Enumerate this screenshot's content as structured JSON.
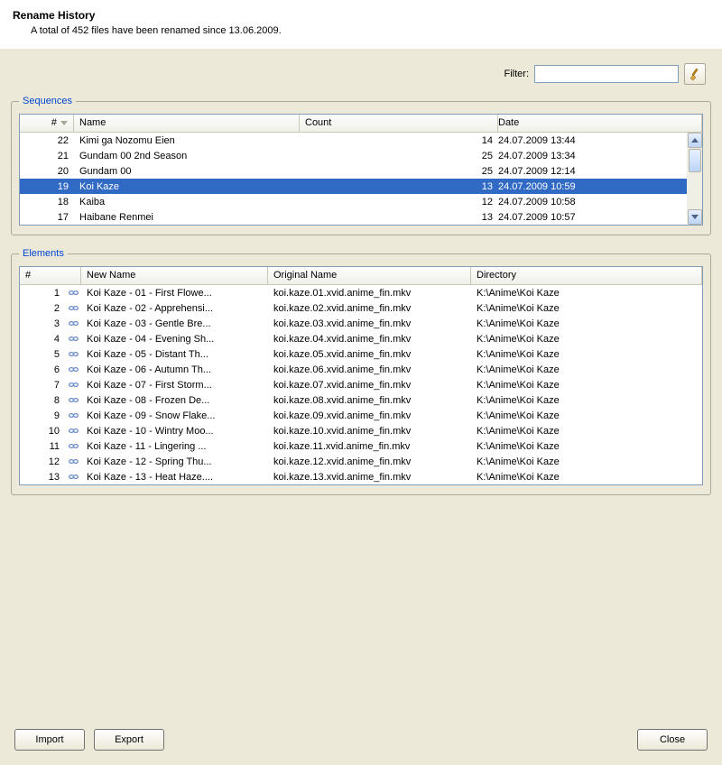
{
  "header": {
    "title": "Rename History",
    "subtitle": "A total of 452 files have been renamed since 13.06.2009."
  },
  "filter": {
    "label": "Filter:",
    "value": ""
  },
  "sequences": {
    "legend": "Sequences",
    "columns": {
      "num": "#",
      "name": "Name",
      "count": "Count",
      "date": "Date"
    },
    "rows": [
      {
        "num": "22",
        "name": "Kimi ga Nozomu Eien",
        "count": "14",
        "date": "24.07.2009 13:44",
        "selected": false
      },
      {
        "num": "21",
        "name": "Gundam 00 2nd Season",
        "count": "25",
        "date": "24.07.2009 13:34",
        "selected": false
      },
      {
        "num": "20",
        "name": "Gundam 00",
        "count": "25",
        "date": "24.07.2009 12:14",
        "selected": false
      },
      {
        "num": "19",
        "name": "Koi Kaze",
        "count": "13",
        "date": "24.07.2009 10:59",
        "selected": true
      },
      {
        "num": "18",
        "name": "Kaiba",
        "count": "12",
        "date": "24.07.2009 10:58",
        "selected": false
      },
      {
        "num": "17",
        "name": "Haibane Renmei",
        "count": "13",
        "date": "24.07.2009 10:57",
        "selected": false
      }
    ]
  },
  "elements": {
    "legend": "Elements",
    "columns": {
      "num": "#",
      "new": "New Name",
      "orig": "Original Name",
      "dir": "Directory"
    },
    "rows": [
      {
        "num": "1",
        "new": "Koi Kaze - 01 - First Flowe...",
        "orig": "koi.kaze.01.xvid.anime_fin.mkv",
        "dir": "K:\\Anime\\Koi Kaze"
      },
      {
        "num": "2",
        "new": "Koi Kaze - 02 - Apprehensi...",
        "orig": "koi.kaze.02.xvid.anime_fin.mkv",
        "dir": "K:\\Anime\\Koi Kaze"
      },
      {
        "num": "3",
        "new": "Koi Kaze - 03 - Gentle Bre...",
        "orig": "koi.kaze.03.xvid.anime_fin.mkv",
        "dir": "K:\\Anime\\Koi Kaze"
      },
      {
        "num": "4",
        "new": "Koi Kaze - 04 - Evening Sh...",
        "orig": "koi.kaze.04.xvid.anime_fin.mkv",
        "dir": "K:\\Anime\\Koi Kaze"
      },
      {
        "num": "5",
        "new": "Koi Kaze - 05 - Distant Th...",
        "orig": "koi.kaze.05.xvid.anime_fin.mkv",
        "dir": "K:\\Anime\\Koi Kaze"
      },
      {
        "num": "6",
        "new": "Koi Kaze - 06 - Autumn Th...",
        "orig": "koi.kaze.06.xvid.anime_fin.mkv",
        "dir": "K:\\Anime\\Koi Kaze"
      },
      {
        "num": "7",
        "new": "Koi Kaze - 07 - First Storm...",
        "orig": "koi.kaze.07.xvid.anime_fin.mkv",
        "dir": "K:\\Anime\\Koi Kaze"
      },
      {
        "num": "8",
        "new": "Koi Kaze - 08 - Frozen De...",
        "orig": "koi.kaze.08.xvid.anime_fin.mkv",
        "dir": "K:\\Anime\\Koi Kaze"
      },
      {
        "num": "9",
        "new": "Koi Kaze - 09 - Snow Flake...",
        "orig": "koi.kaze.09.xvid.anime_fin.mkv",
        "dir": "K:\\Anime\\Koi Kaze"
      },
      {
        "num": "10",
        "new": "Koi Kaze - 10 - Wintry Moo...",
        "orig": "koi.kaze.10.xvid.anime_fin.mkv",
        "dir": "K:\\Anime\\Koi Kaze"
      },
      {
        "num": "11",
        "new": "Koi Kaze - 11 - Lingering ...",
        "orig": "koi.kaze.11.xvid.anime_fin.mkv",
        "dir": "K:\\Anime\\Koi Kaze"
      },
      {
        "num": "12",
        "new": "Koi Kaze - 12 - Spring Thu...",
        "orig": "koi.kaze.12.xvid.anime_fin.mkv",
        "dir": "K:\\Anime\\Koi Kaze"
      },
      {
        "num": "13",
        "new": "Koi Kaze - 13 - Heat Haze....",
        "orig": "koi.kaze.13.xvid.anime_fin.mkv",
        "dir": "K:\\Anime\\Koi Kaze"
      }
    ]
  },
  "buttons": {
    "import": "Import",
    "export": "Export",
    "close": "Close"
  }
}
